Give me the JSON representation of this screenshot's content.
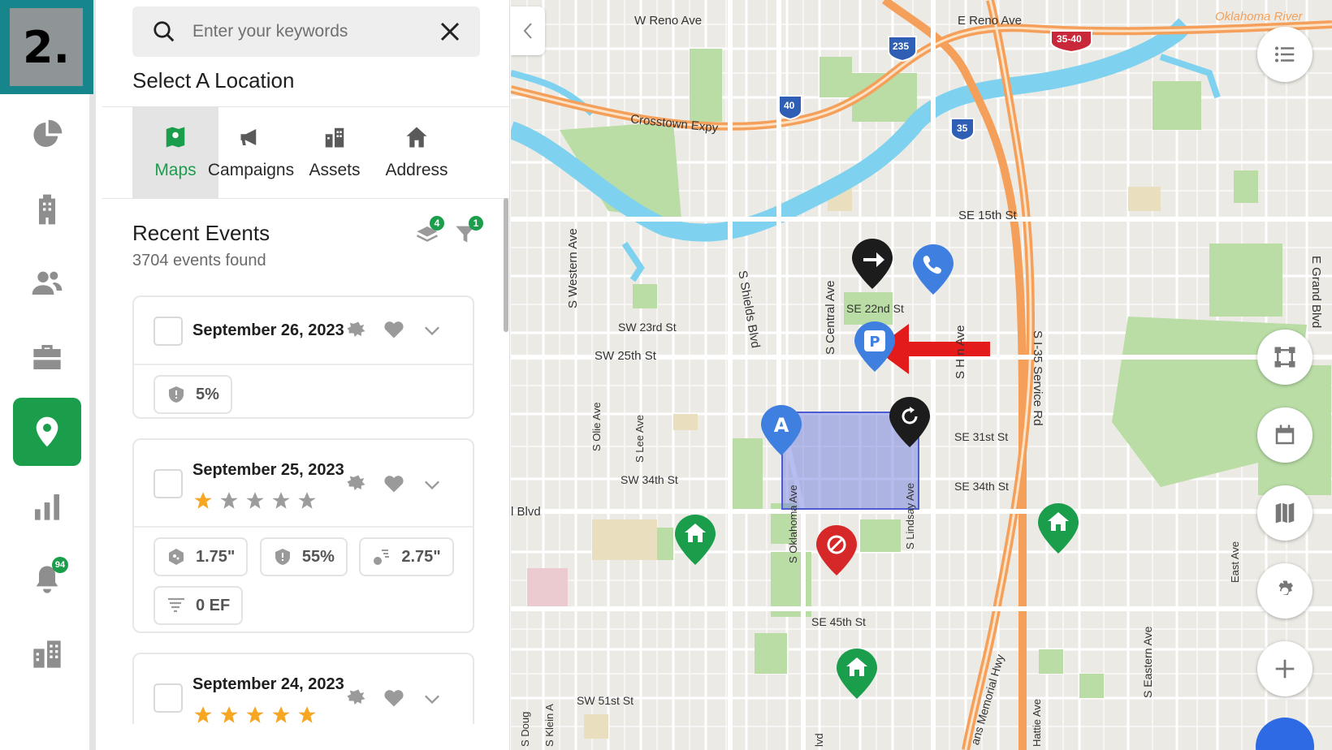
{
  "step_badge": "2.",
  "rail": {
    "items": [
      {
        "name": "dashboard",
        "icon": "pie-chart-icon"
      },
      {
        "name": "buildings",
        "icon": "building-icon"
      },
      {
        "name": "contacts",
        "icon": "users-icon"
      },
      {
        "name": "jobs",
        "icon": "briefcase-icon"
      },
      {
        "name": "locations",
        "icon": "location-pin-icon",
        "active": true
      },
      {
        "name": "reports",
        "icon": "bar-chart-icon"
      },
      {
        "name": "notifications",
        "icon": "bell-icon",
        "badge": "94"
      },
      {
        "name": "assets",
        "icon": "city-icon"
      }
    ]
  },
  "search": {
    "placeholder": "Enter your keywords"
  },
  "select_location": {
    "title": "Select A Location",
    "tabs": [
      {
        "label": "Maps",
        "icon": "map-icon",
        "active": true
      },
      {
        "label": "Campaigns",
        "icon": "megaphone-icon"
      },
      {
        "label": "Assets",
        "icon": "assets-icon"
      },
      {
        "label": "Address",
        "icon": "home-icon"
      }
    ]
  },
  "recent_events": {
    "title": "Recent Events",
    "count_text": "3704 events found",
    "layers_badge": "4",
    "filter_badge": "1",
    "events": [
      {
        "date": "September 26, 2023",
        "stars": 0,
        "chips": [
          {
            "icon": "shield-alert-icon",
            "text": "5%"
          }
        ]
      },
      {
        "date": "September 25, 2023",
        "stars": 1,
        "chips": [
          {
            "icon": "hail-icon",
            "text": "1.75\""
          },
          {
            "icon": "shield-alert-icon",
            "text": "55%"
          },
          {
            "icon": "wind-hail-icon",
            "text": "2.75\""
          },
          {
            "icon": "tornado-icon",
            "text": "0 EF"
          }
        ]
      },
      {
        "date": "September 24, 2023",
        "stars": 5,
        "chips": []
      }
    ]
  },
  "map": {
    "labels": {
      "w_reno": "W Reno Ave",
      "e_reno": "E Reno Ave",
      "oklahoma_river": "Oklahoma River",
      "crosstown": "Crosstown Expy",
      "se15": "SE 15th St",
      "se22": "SE 22nd St",
      "sw23": "SW 23rd St",
      "sw25": "SW 25th St",
      "se31": "SE 31st St",
      "sw34": "SW 34th St",
      "se34": "SE 34th St",
      "se45": "SE 45th St",
      "sw51": "SW 51st St",
      "blvd": "l Blvd",
      "s_western": "S Western Ave",
      "s_shields": "S Shields Blvd",
      "s_central": "S Central Ave",
      "s_h": "S H    n Ave",
      "i35_service": "S I-35 Service Rd",
      "e_grand": "E Grand Blvd",
      "s_olie": "S Olie Ave",
      "s_lee": "S Lee Ave",
      "s_oklahoma": "S Oklahoma Ave",
      "s_lindsay": "S Lindsay Ave",
      "east_ave": "East Ave",
      "s_eastern": "S Eastern Ave",
      "hattie": "Hattie Ave",
      "memorial": "ans Memorial Hwy",
      "s_klein": "S Klein A",
      "s_doug": "S Doug",
      "lvd": "lvd",
      "shield_235": "235",
      "shield_40": "40",
      "shield_3540": "35-40",
      "shield_35": "35"
    },
    "colors": {
      "highway": "#f5a05a",
      "river": "#7fd2ef",
      "park": "#b9dda5",
      "selection": "#7b86e0",
      "pin_blue": "#3f7fe0",
      "pin_green": "#1a9e4c",
      "pin_black": "#1c1c1c",
      "pin_red": "#d62828",
      "arrow": "#e41b1b"
    }
  }
}
